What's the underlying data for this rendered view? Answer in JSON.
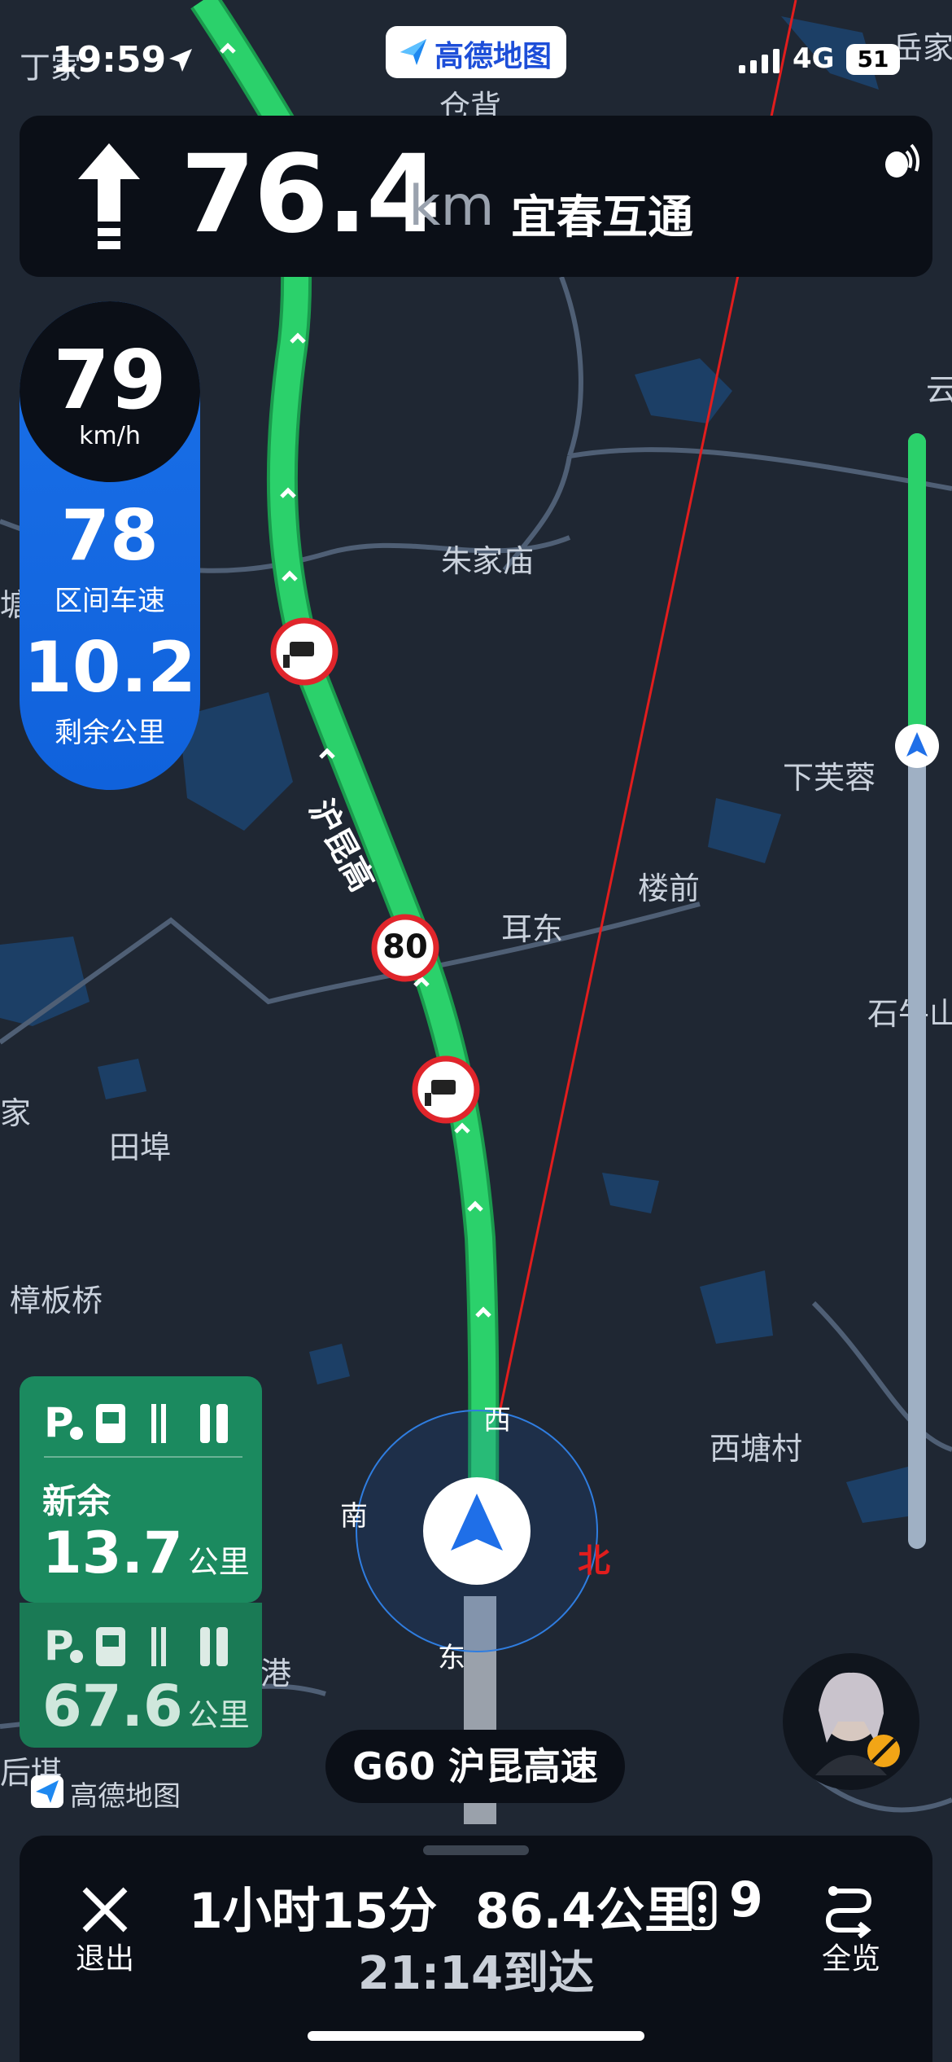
{
  "status_bar": {
    "time": "19:59",
    "network": "4G",
    "battery": "51"
  },
  "brand": {
    "name": "高德地图"
  },
  "guidance": {
    "distance": "76.4",
    "unit": "km",
    "road_name": "宜春互通"
  },
  "speed_panel": {
    "current_speed": "79",
    "speed_unit": "km/h",
    "section_avg_speed": "78",
    "section_avg_label": "区间车速",
    "remaining": "10.2",
    "remaining_label": "剩余公里"
  },
  "progress": {
    "completed_fraction": 0.28
  },
  "map": {
    "labels": [
      "仓背",
      "丁家",
      "岳家",
      "朱家庙",
      "下芙蓉",
      "楼前",
      "耳东",
      "石牛山",
      "田埠",
      "樟板桥",
      "西塘村",
      "塘",
      "云",
      "家",
      "港",
      "后堪"
    ],
    "highway_label": "沪昆高",
    "speed_limit": "80",
    "compass": {
      "west": "西",
      "south": "南",
      "north": "北",
      "east": "东"
    },
    "colors": {
      "route": "#2bd16b",
      "background": "#1f2733",
      "compass_line": "#e11d1d"
    }
  },
  "service_areas": [
    {
      "name": "新余",
      "distance": "13.7",
      "unit": "公里"
    },
    {
      "distance": "67.6",
      "unit": "公里"
    }
  ],
  "watermark": {
    "text": "高德地图"
  },
  "current_road": "G60 沪昆高速",
  "bottom_bar": {
    "exit_label": "退出",
    "duration": "1小时15分",
    "distance": "86.4公里",
    "traffic_lights": "9",
    "arrival": "21:14到达",
    "overview_label": "全览"
  }
}
